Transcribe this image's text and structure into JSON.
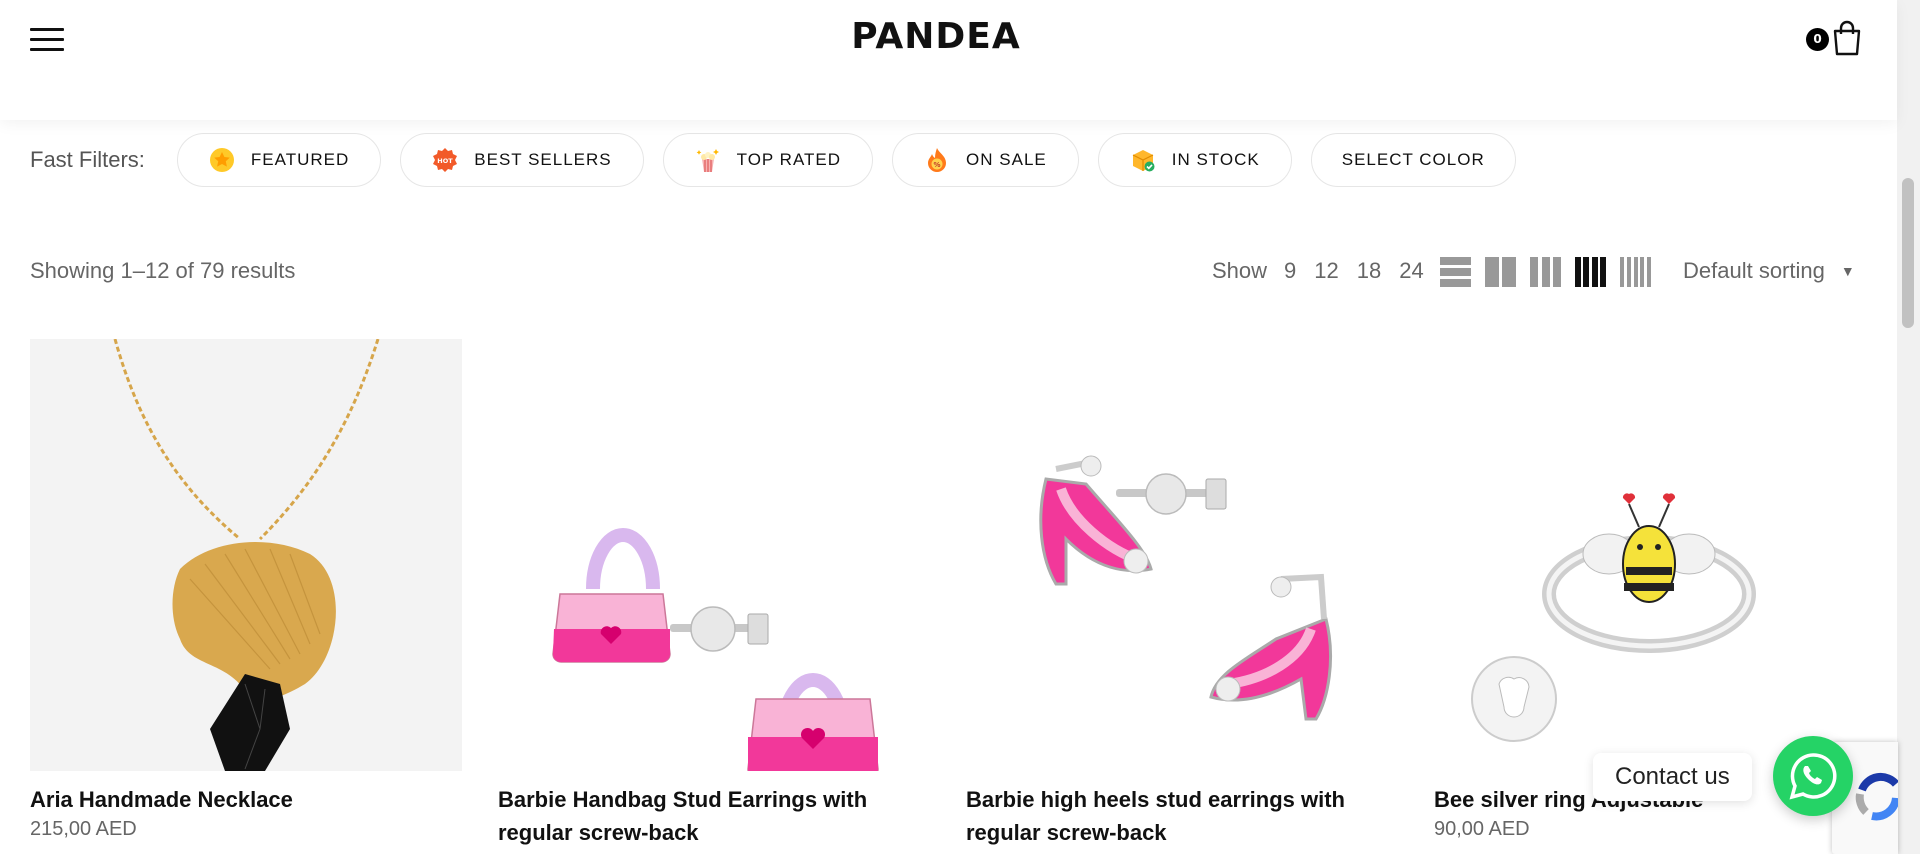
{
  "header": {
    "logo": "PANDEA",
    "cart_count": "0"
  },
  "filters": {
    "label": "Fast Filters:",
    "chips": [
      {
        "label": "FEATURED",
        "icon": "star-badge-icon"
      },
      {
        "label": "BEST SELLERS",
        "icon": "hot-badge-icon"
      },
      {
        "label": "TOP RATED",
        "icon": "popcorn-sparkle-icon"
      },
      {
        "label": "ON SALE",
        "icon": "percent-flame-icon"
      },
      {
        "label": "IN STOCK",
        "icon": "box-check-icon"
      },
      {
        "label": "SELECT COLOR",
        "icon": ""
      }
    ]
  },
  "toolbar": {
    "results_text": "Showing 1–12 of 79 results",
    "show_label": "Show",
    "show_options": [
      "9",
      "12",
      "18",
      "24"
    ],
    "view_columns": [
      1,
      2,
      3,
      4,
      5
    ],
    "active_view_columns": 4,
    "sort_label": "Default sorting"
  },
  "products": [
    {
      "name": "Aria Handmade Necklace",
      "price": "215,00 AED"
    },
    {
      "name": "Barbie Handbag Stud Earrings with regular screw-back",
      "price": ""
    },
    {
      "name": "Barbie high heels stud earrings with regular screw-back",
      "price": ""
    },
    {
      "name": "Bee silver ring Adjustable",
      "price": "90,00 AED"
    }
  ],
  "contact": {
    "label": "Contact us"
  },
  "colors": {
    "whatsapp": "#25d366",
    "pink": "#f2389a",
    "light_pink": "#f9b3d6",
    "lavender": "#d9b8ee",
    "gold": "#d6a54a"
  }
}
